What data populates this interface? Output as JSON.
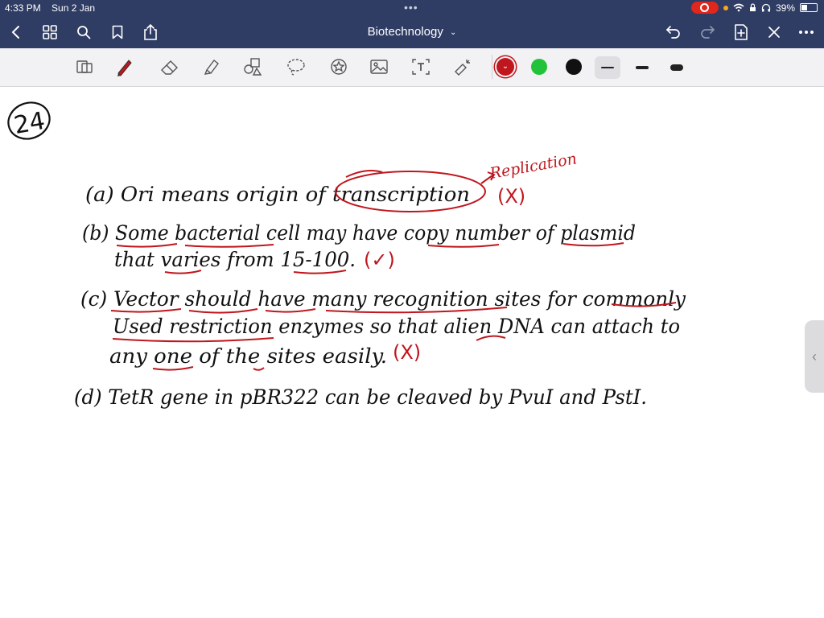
{
  "status_bar": {
    "time": "4:33 PM",
    "date": "Sun 2 Jan",
    "battery": "39%"
  },
  "nav": {
    "title": "Biotechnology"
  },
  "icons": {
    "back": "chevron-left-icon",
    "grid": "grid-icon",
    "search": "search-icon",
    "bookmark": "bookmark-icon",
    "share": "share-icon",
    "undo": "undo-icon",
    "redo": "redo-icon",
    "add_page": "add-page-icon",
    "close": "close-icon",
    "more": "more-icon"
  },
  "toolbar": {
    "tools": [
      "scan-icon",
      "pen-icon",
      "eraser-icon",
      "highlighter-icon",
      "shapes-icon",
      "lasso-icon",
      "sticker-icon",
      "image-icon",
      "text-icon",
      "laser-icon"
    ],
    "active_tool": "pen",
    "colors": [
      "#c0161d",
      "#22c33a",
      "#111111"
    ],
    "selected_color": "#c0161d",
    "stroke_widths": [
      "thin",
      "medium",
      "thick"
    ],
    "selected_stroke": "thin"
  },
  "note": {
    "question_number": "24",
    "correction_label": "Replication",
    "lines": [
      {
        "id": "a",
        "text": "(a) Ori means origin of transcription",
        "mark": "(X)"
      },
      {
        "id": "b1",
        "text": "(b) Some bacterial cell may have copy number of plasmid"
      },
      {
        "id": "b2",
        "text": "that varies from 15-100.",
        "mark": "(✓)"
      },
      {
        "id": "c1",
        "text": "(c) Vector should have many recognition sites for commonly"
      },
      {
        "id": "c2",
        "text": "Used restriction enzymes so that alien DNA can attach to"
      },
      {
        "id": "c3",
        "text": "any one of the sites easily.",
        "mark": "(X)"
      },
      {
        "id": "d",
        "text": "(d) TetR gene in pBR322 can be cleaved by PvuI and PstI."
      }
    ]
  }
}
